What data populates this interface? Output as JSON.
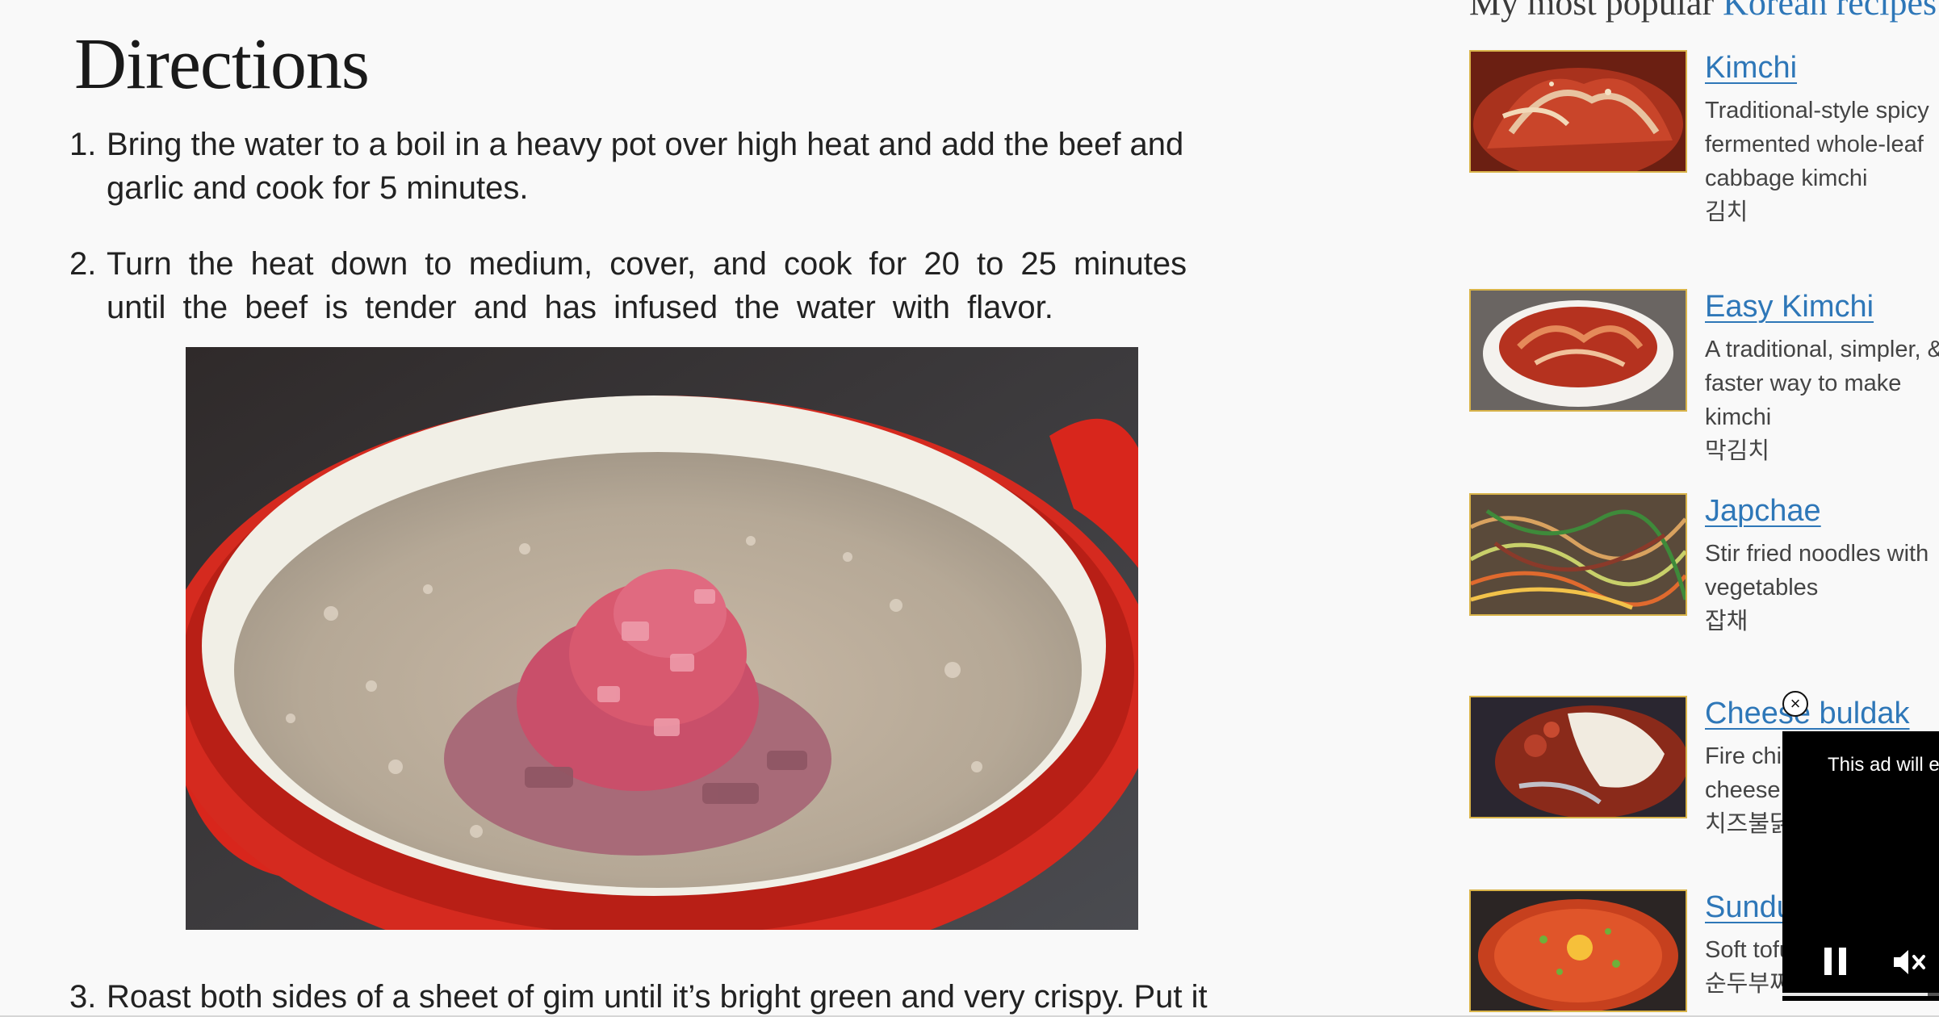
{
  "directions": {
    "heading": "Directions",
    "steps": [
      {
        "num": "1.",
        "text": "Bring the water to a boil in a heavy pot over high heat and add the beef and garlic and cook for 5 minutes."
      },
      {
        "num": "2.",
        "text": "Turn the heat down to medium, cover, and cook for 20 to 25 minutes until the beef is tender and has infused the water with flavor."
      },
      {
        "num": "3.",
        "text": "Roast both sides of a sheet of gim until it’s bright green and very crispy. Put it"
      }
    ],
    "photo_icon": "cooking-photo"
  },
  "sidebar": {
    "heading_prefix": "My most popular ",
    "heading_accent": "Korean recipes",
    "accent_color": "#2e77b8",
    "recipes": [
      {
        "title": "Kimchi",
        "description": "Traditional-style spicy fermented whole-leaf cabbage kimchi",
        "korean": "김치"
      },
      {
        "title": "Easy Kimchi",
        "description": "A traditional, simpler, & faster way to make kimchi",
        "korean": "막김치"
      },
      {
        "title": "Japchae",
        "description": "Stir fried noodles with vegetables",
        "korean": "잡채"
      },
      {
        "title": "Cheese buldak",
        "description": "Fire chicken with cheese",
        "korean": "치즈불닭"
      },
      {
        "title": "Sundubu-jjigae",
        "description": "Soft tofu stew",
        "korean": "순두부찌개"
      }
    ]
  },
  "ad": {
    "text": "This ad will end in",
    "close_glyph": "×",
    "progress": 0.9,
    "icons": [
      "close-icon",
      "pause-icon",
      "mute-icon"
    ]
  }
}
